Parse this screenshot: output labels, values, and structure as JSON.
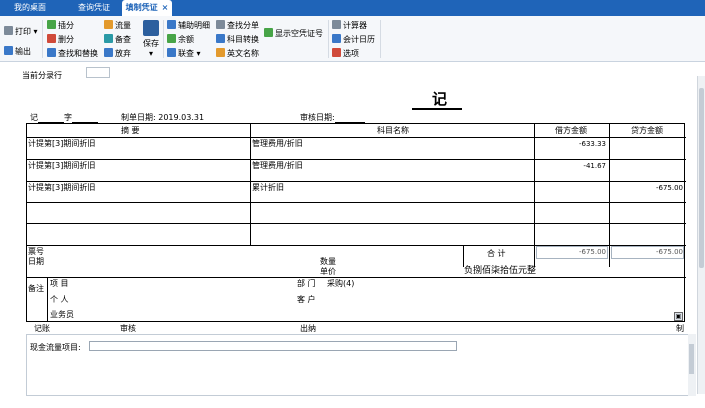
{
  "tabs": [
    {
      "label": "我的桌面"
    },
    {
      "label": "查询凭证"
    },
    {
      "label": "填制凭证"
    }
  ],
  "ribbon": {
    "print": "打印",
    "output": "输出",
    "insert": "插分",
    "delete": "删分",
    "find_replace": "查找和替换",
    "flow": "流量",
    "check": "备查",
    "void": "放弃",
    "save": "保存",
    "aux_detail": "辅助明细",
    "balance": "余额",
    "link": "联查",
    "find_entry": "查找分单",
    "account_convert": "科目转换",
    "english_name": "英文名称",
    "show_empty": "显示空凭证号",
    "calculator": "计算器",
    "calendar": "会计日历",
    "options": "选项"
  },
  "current_entry_label": "当前分录行",
  "voucher": {
    "title": "记",
    "type_label": "记",
    "no_label": "字",
    "date_label": "制单日期:",
    "date_value": "2019.03.31",
    "audit_label": "审核日期:",
    "col_summary": "摘 要",
    "col_account": "科目名称",
    "col_debit": "借方金额",
    "col_credit": "贷方金额",
    "rows": [
      {
        "summary": "计提第[3]期间折旧",
        "account": "管理费用/折旧",
        "debit": "-633.33",
        "credit": ""
      },
      {
        "summary": "计提第[3]期间折旧",
        "account": "管理费用/折旧",
        "debit": "-41.67",
        "credit": ""
      },
      {
        "summary": "计提第[3]期间折旧",
        "account": "累计折旧",
        "debit": "",
        "credit": "-675.00"
      },
      {
        "summary": "",
        "account": "",
        "debit": "",
        "credit": ""
      },
      {
        "summary": "",
        "account": "",
        "debit": "",
        "credit": ""
      }
    ],
    "bill_no_label": "票号",
    "bill_date_label": "日期",
    "qty_label": "数量",
    "unit_price_label": "单价",
    "total_label": "合 计",
    "total_debit": "-675.00",
    "total_credit": "-675.00",
    "total_words": "负捌佰柒拾伍元整",
    "remark_label": "备注",
    "project_label": "项 目",
    "dept_label": "部 门",
    "dept_value": "采购(4)",
    "person_label": "个 人",
    "customer_label": "客 户",
    "salesman_label": "业务员"
  },
  "footer": {
    "bookkeeper": "记账",
    "auditor": "审核",
    "cashier": "出纳",
    "maker": "制"
  },
  "cashflow_label": "现金流量项目:"
}
